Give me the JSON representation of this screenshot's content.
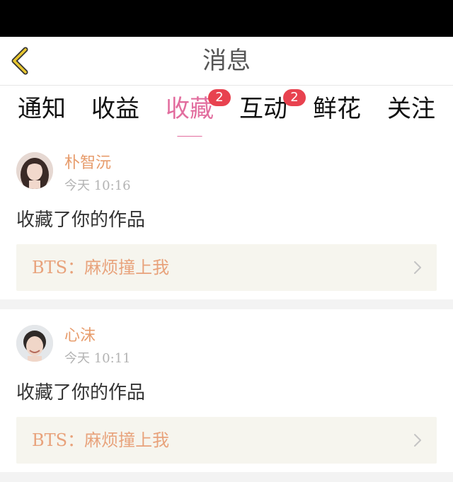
{
  "header": {
    "title": "消息",
    "back_icon": "chevron-left-icon"
  },
  "tabs": [
    {
      "label": "通知",
      "active": false,
      "badge": ""
    },
    {
      "label": "收益",
      "active": false,
      "badge": ""
    },
    {
      "label": "收藏",
      "active": true,
      "badge": "2"
    },
    {
      "label": "互动",
      "active": false,
      "badge": "2"
    },
    {
      "label": "鲜花",
      "active": false,
      "badge": ""
    },
    {
      "label": "关注",
      "active": false,
      "badge": ""
    }
  ],
  "notifications": [
    {
      "username": "朴智沅",
      "time": "今天 10:16",
      "action": "收藏了你的作品",
      "work_title": "BTS：麻烦撞上我",
      "avatar_icon": "avatar-icon"
    },
    {
      "username": "心沫",
      "time": "今天 10:11",
      "action": "收藏了你的作品",
      "work_title": "BTS：麻烦撞上我",
      "avatar_icon": "avatar-icon"
    }
  ],
  "colors": {
    "accent": "#e26d9e",
    "badge": "#e8424f",
    "username": "#e79c6c",
    "work_title": "#e8a27b",
    "card_bg": "#f6f5ee",
    "back_icon": "#e7c62f",
    "status_bar": "#000000"
  }
}
